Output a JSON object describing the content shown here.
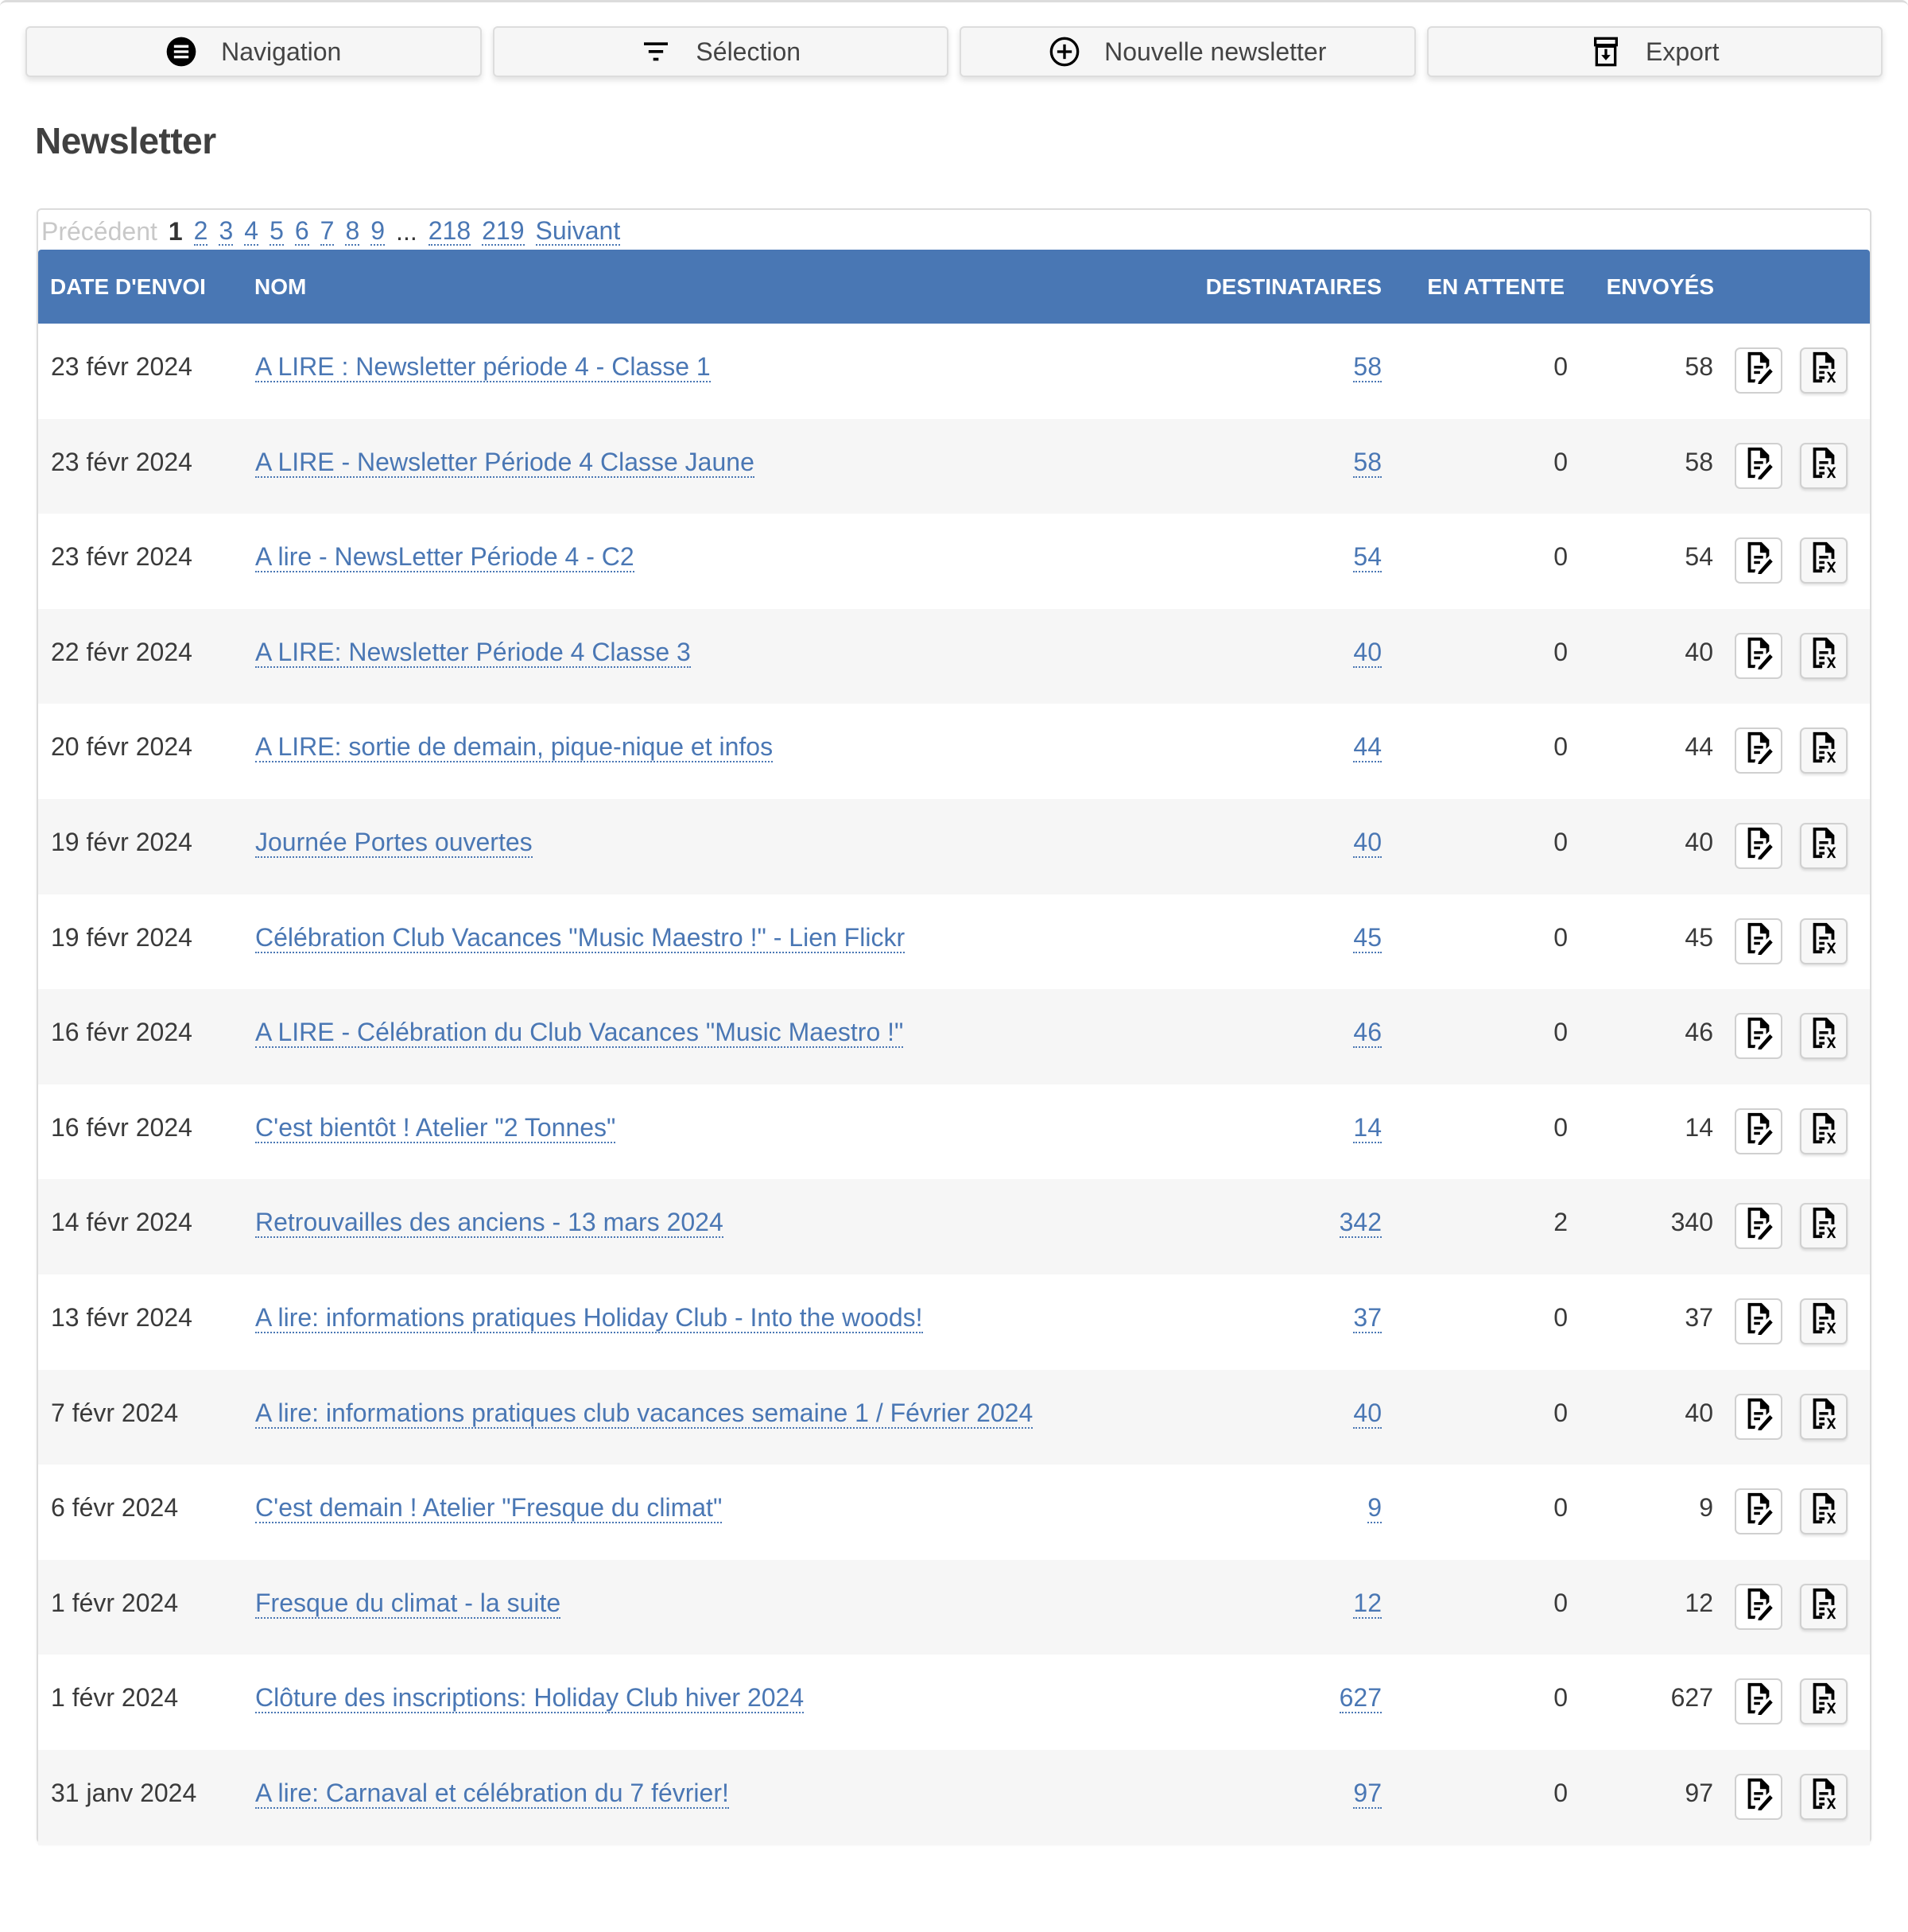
{
  "toolbar": {
    "navigation": {
      "label": "Navigation",
      "icon": "menu-circle-icon"
    },
    "selection": {
      "label": "Sélection",
      "icon": "filter-icon"
    },
    "new_newsletter": {
      "label": "Nouvelle newsletter",
      "icon": "plus-circle-icon"
    },
    "export": {
      "label": "Export",
      "icon": "archive-download-icon"
    }
  },
  "page_title": "Newsletter",
  "pagination": {
    "previous": "Précédent",
    "current": "1",
    "pages": [
      "2",
      "3",
      "4",
      "5",
      "6",
      "7",
      "8",
      "9"
    ],
    "ellipsis": "...",
    "last_pages": [
      "218",
      "219"
    ],
    "next": "Suivant"
  },
  "table": {
    "columns": {
      "date": "DATE D'ENVOI",
      "name": "NOM",
      "recipients": "DESTINATAIRES",
      "pending": "EN ATTENTE",
      "sent": "ENVOYÉS"
    },
    "row_actions": {
      "edit_icon": "document-edit-icon",
      "delete_icon": "document-delete-icon"
    },
    "rows": [
      {
        "date": "23 févr 2024",
        "name": "A LIRE : Newsletter période 4 - Classe 1",
        "recipients": "58",
        "pending": "0",
        "sent": "58"
      },
      {
        "date": "23 févr 2024",
        "name": "A LIRE - Newsletter Période 4 Classe Jaune",
        "recipients": "58",
        "pending": "0",
        "sent": "58"
      },
      {
        "date": "23 févr 2024",
        "name": "A lire - NewsLetter Période 4 - C2",
        "recipients": "54",
        "pending": "0",
        "sent": "54"
      },
      {
        "date": "22 févr 2024",
        "name": "A LIRE: Newsletter Période 4 Classe 3",
        "recipients": "40",
        "pending": "0",
        "sent": "40"
      },
      {
        "date": "20 févr 2024",
        "name": "A LIRE: sortie de demain, pique-nique et infos",
        "recipients": "44",
        "pending": "0",
        "sent": "44"
      },
      {
        "date": "19 févr 2024",
        "name": "Journée Portes ouvertes",
        "recipients": "40",
        "pending": "0",
        "sent": "40"
      },
      {
        "date": "19 févr 2024",
        "name": "Célébration Club Vacances \"Music Maestro !\" - Lien Flickr",
        "recipients": "45",
        "pending": "0",
        "sent": "45"
      },
      {
        "date": "16 févr 2024",
        "name": "A LIRE - Célébration du Club Vacances \"Music Maestro !\"",
        "recipients": "46",
        "pending": "0",
        "sent": "46"
      },
      {
        "date": "16 févr 2024",
        "name": "C'est bientôt ! Atelier \"2 Tonnes\"",
        "recipients": "14",
        "pending": "0",
        "sent": "14"
      },
      {
        "date": "14 févr 2024",
        "name": "Retrouvailles des anciens - 13 mars 2024",
        "recipients": "342",
        "pending": "2",
        "sent": "340"
      },
      {
        "date": "13 févr 2024",
        "name": "A lire: informations pratiques Holiday Club - Into the woods!",
        "recipients": "37",
        "pending": "0",
        "sent": "37"
      },
      {
        "date": "7 févr 2024",
        "name": "A lire: informations pratiques club vacances semaine 1 / Février 2024",
        "recipients": "40",
        "pending": "0",
        "sent": "40"
      },
      {
        "date": "6 févr 2024",
        "name": "C'est demain ! Atelier \"Fresque du climat\"",
        "recipients": "9",
        "pending": "0",
        "sent": "9"
      },
      {
        "date": "1 févr 2024",
        "name": "Fresque du climat - la suite",
        "recipients": "12",
        "pending": "0",
        "sent": "12"
      },
      {
        "date": "1 févr 2024",
        "name": "Clôture des inscriptions: Holiday Club hiver 2024",
        "recipients": "627",
        "pending": "0",
        "sent": "627"
      },
      {
        "date": "31 janv 2024",
        "name": "A lire: Carnaval et célébration du 7 février!",
        "recipients": "97",
        "pending": "0",
        "sent": "97"
      }
    ]
  },
  "colors": {
    "header_bg": "#4977b4",
    "link": "#4a77b4",
    "row_alt": "#f6f6f6",
    "text": "#333333",
    "disabled": "#c8c8c8"
  }
}
